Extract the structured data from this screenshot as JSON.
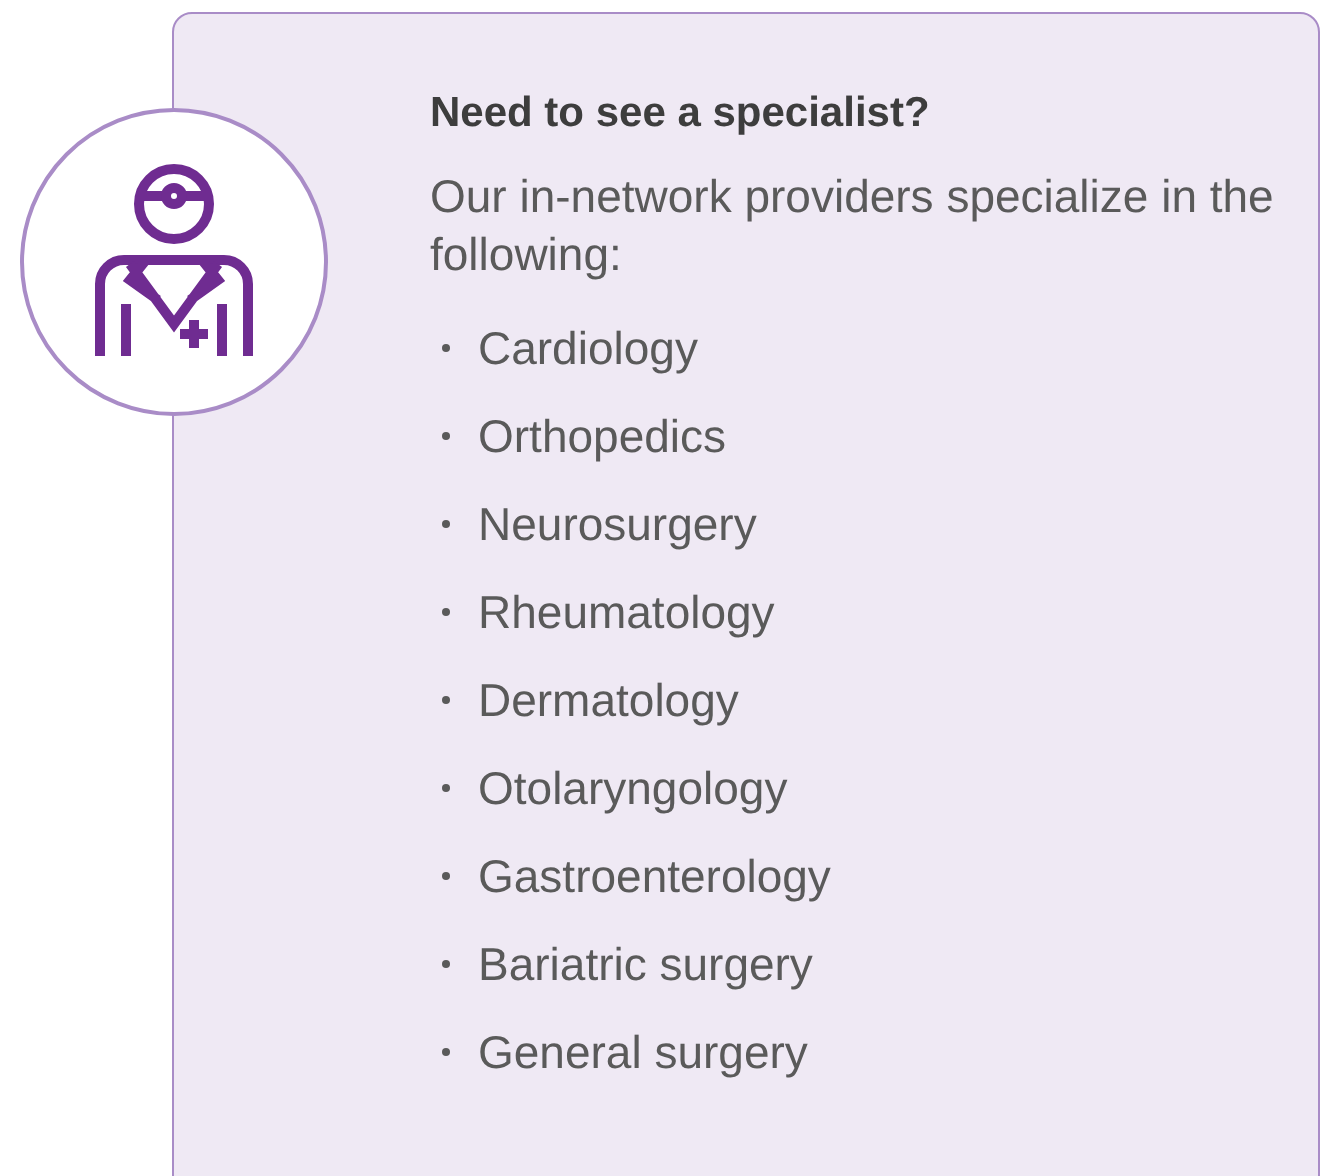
{
  "heading": "Need to see a specialist?",
  "intro": "Our in-network providers specialize in the following:",
  "specialties": [
    "Cardiology",
    "Orthopedics",
    "Neurosurgery",
    "Rheumatology",
    "Dermatology",
    "Otolaryngology",
    "Gastroenterology",
    "Bariatric surgery",
    "General surgery"
  ]
}
